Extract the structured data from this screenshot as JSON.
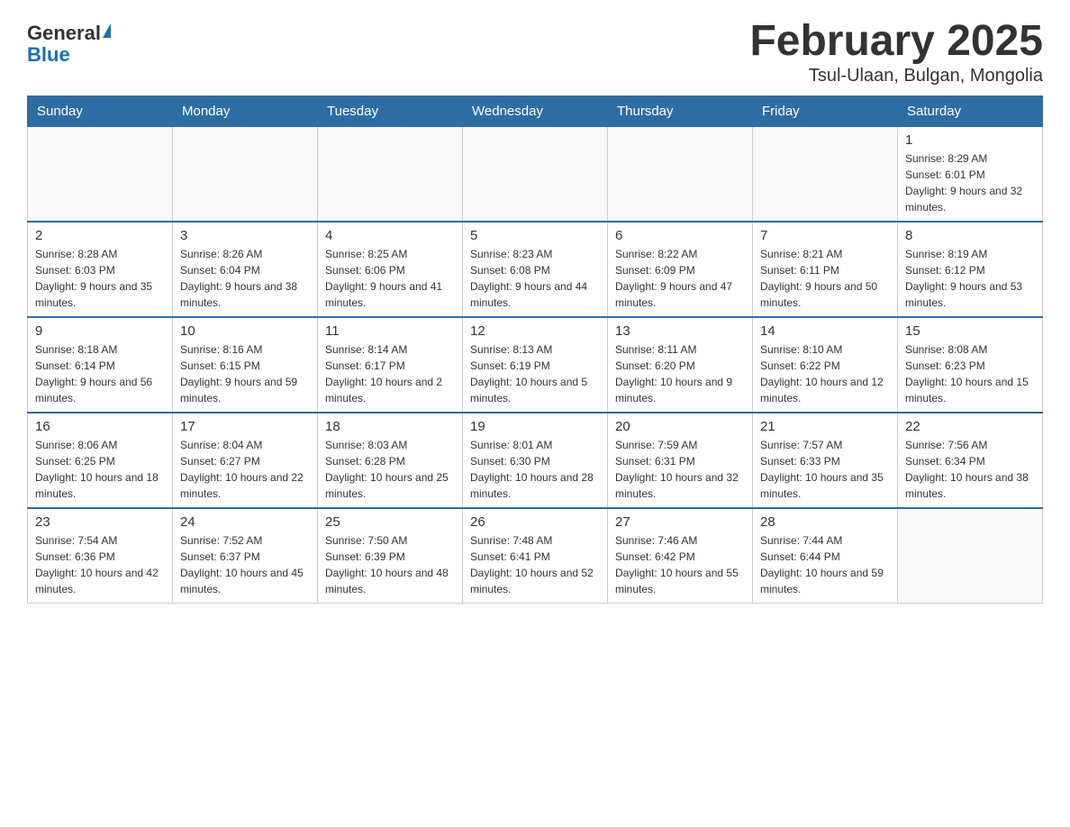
{
  "header": {
    "logo_general": "General",
    "logo_blue": "Blue",
    "title": "February 2025",
    "subtitle": "Tsul-Ulaan, Bulgan, Mongolia"
  },
  "weekdays": [
    "Sunday",
    "Monday",
    "Tuesday",
    "Wednesday",
    "Thursday",
    "Friday",
    "Saturday"
  ],
  "weeks": [
    [
      {
        "day": "",
        "info": ""
      },
      {
        "day": "",
        "info": ""
      },
      {
        "day": "",
        "info": ""
      },
      {
        "day": "",
        "info": ""
      },
      {
        "day": "",
        "info": ""
      },
      {
        "day": "",
        "info": ""
      },
      {
        "day": "1",
        "info": "Sunrise: 8:29 AM\nSunset: 6:01 PM\nDaylight: 9 hours and 32 minutes."
      }
    ],
    [
      {
        "day": "2",
        "info": "Sunrise: 8:28 AM\nSunset: 6:03 PM\nDaylight: 9 hours and 35 minutes."
      },
      {
        "day": "3",
        "info": "Sunrise: 8:26 AM\nSunset: 6:04 PM\nDaylight: 9 hours and 38 minutes."
      },
      {
        "day": "4",
        "info": "Sunrise: 8:25 AM\nSunset: 6:06 PM\nDaylight: 9 hours and 41 minutes."
      },
      {
        "day": "5",
        "info": "Sunrise: 8:23 AM\nSunset: 6:08 PM\nDaylight: 9 hours and 44 minutes."
      },
      {
        "day": "6",
        "info": "Sunrise: 8:22 AM\nSunset: 6:09 PM\nDaylight: 9 hours and 47 minutes."
      },
      {
        "day": "7",
        "info": "Sunrise: 8:21 AM\nSunset: 6:11 PM\nDaylight: 9 hours and 50 minutes."
      },
      {
        "day": "8",
        "info": "Sunrise: 8:19 AM\nSunset: 6:12 PM\nDaylight: 9 hours and 53 minutes."
      }
    ],
    [
      {
        "day": "9",
        "info": "Sunrise: 8:18 AM\nSunset: 6:14 PM\nDaylight: 9 hours and 56 minutes."
      },
      {
        "day": "10",
        "info": "Sunrise: 8:16 AM\nSunset: 6:15 PM\nDaylight: 9 hours and 59 minutes."
      },
      {
        "day": "11",
        "info": "Sunrise: 8:14 AM\nSunset: 6:17 PM\nDaylight: 10 hours and 2 minutes."
      },
      {
        "day": "12",
        "info": "Sunrise: 8:13 AM\nSunset: 6:19 PM\nDaylight: 10 hours and 5 minutes."
      },
      {
        "day": "13",
        "info": "Sunrise: 8:11 AM\nSunset: 6:20 PM\nDaylight: 10 hours and 9 minutes."
      },
      {
        "day": "14",
        "info": "Sunrise: 8:10 AM\nSunset: 6:22 PM\nDaylight: 10 hours and 12 minutes."
      },
      {
        "day": "15",
        "info": "Sunrise: 8:08 AM\nSunset: 6:23 PM\nDaylight: 10 hours and 15 minutes."
      }
    ],
    [
      {
        "day": "16",
        "info": "Sunrise: 8:06 AM\nSunset: 6:25 PM\nDaylight: 10 hours and 18 minutes."
      },
      {
        "day": "17",
        "info": "Sunrise: 8:04 AM\nSunset: 6:27 PM\nDaylight: 10 hours and 22 minutes."
      },
      {
        "day": "18",
        "info": "Sunrise: 8:03 AM\nSunset: 6:28 PM\nDaylight: 10 hours and 25 minutes."
      },
      {
        "day": "19",
        "info": "Sunrise: 8:01 AM\nSunset: 6:30 PM\nDaylight: 10 hours and 28 minutes."
      },
      {
        "day": "20",
        "info": "Sunrise: 7:59 AM\nSunset: 6:31 PM\nDaylight: 10 hours and 32 minutes."
      },
      {
        "day": "21",
        "info": "Sunrise: 7:57 AM\nSunset: 6:33 PM\nDaylight: 10 hours and 35 minutes."
      },
      {
        "day": "22",
        "info": "Sunrise: 7:56 AM\nSunset: 6:34 PM\nDaylight: 10 hours and 38 minutes."
      }
    ],
    [
      {
        "day": "23",
        "info": "Sunrise: 7:54 AM\nSunset: 6:36 PM\nDaylight: 10 hours and 42 minutes."
      },
      {
        "day": "24",
        "info": "Sunrise: 7:52 AM\nSunset: 6:37 PM\nDaylight: 10 hours and 45 minutes."
      },
      {
        "day": "25",
        "info": "Sunrise: 7:50 AM\nSunset: 6:39 PM\nDaylight: 10 hours and 48 minutes."
      },
      {
        "day": "26",
        "info": "Sunrise: 7:48 AM\nSunset: 6:41 PM\nDaylight: 10 hours and 52 minutes."
      },
      {
        "day": "27",
        "info": "Sunrise: 7:46 AM\nSunset: 6:42 PM\nDaylight: 10 hours and 55 minutes."
      },
      {
        "day": "28",
        "info": "Sunrise: 7:44 AM\nSunset: 6:44 PM\nDaylight: 10 hours and 59 minutes."
      },
      {
        "day": "",
        "info": ""
      }
    ]
  ]
}
